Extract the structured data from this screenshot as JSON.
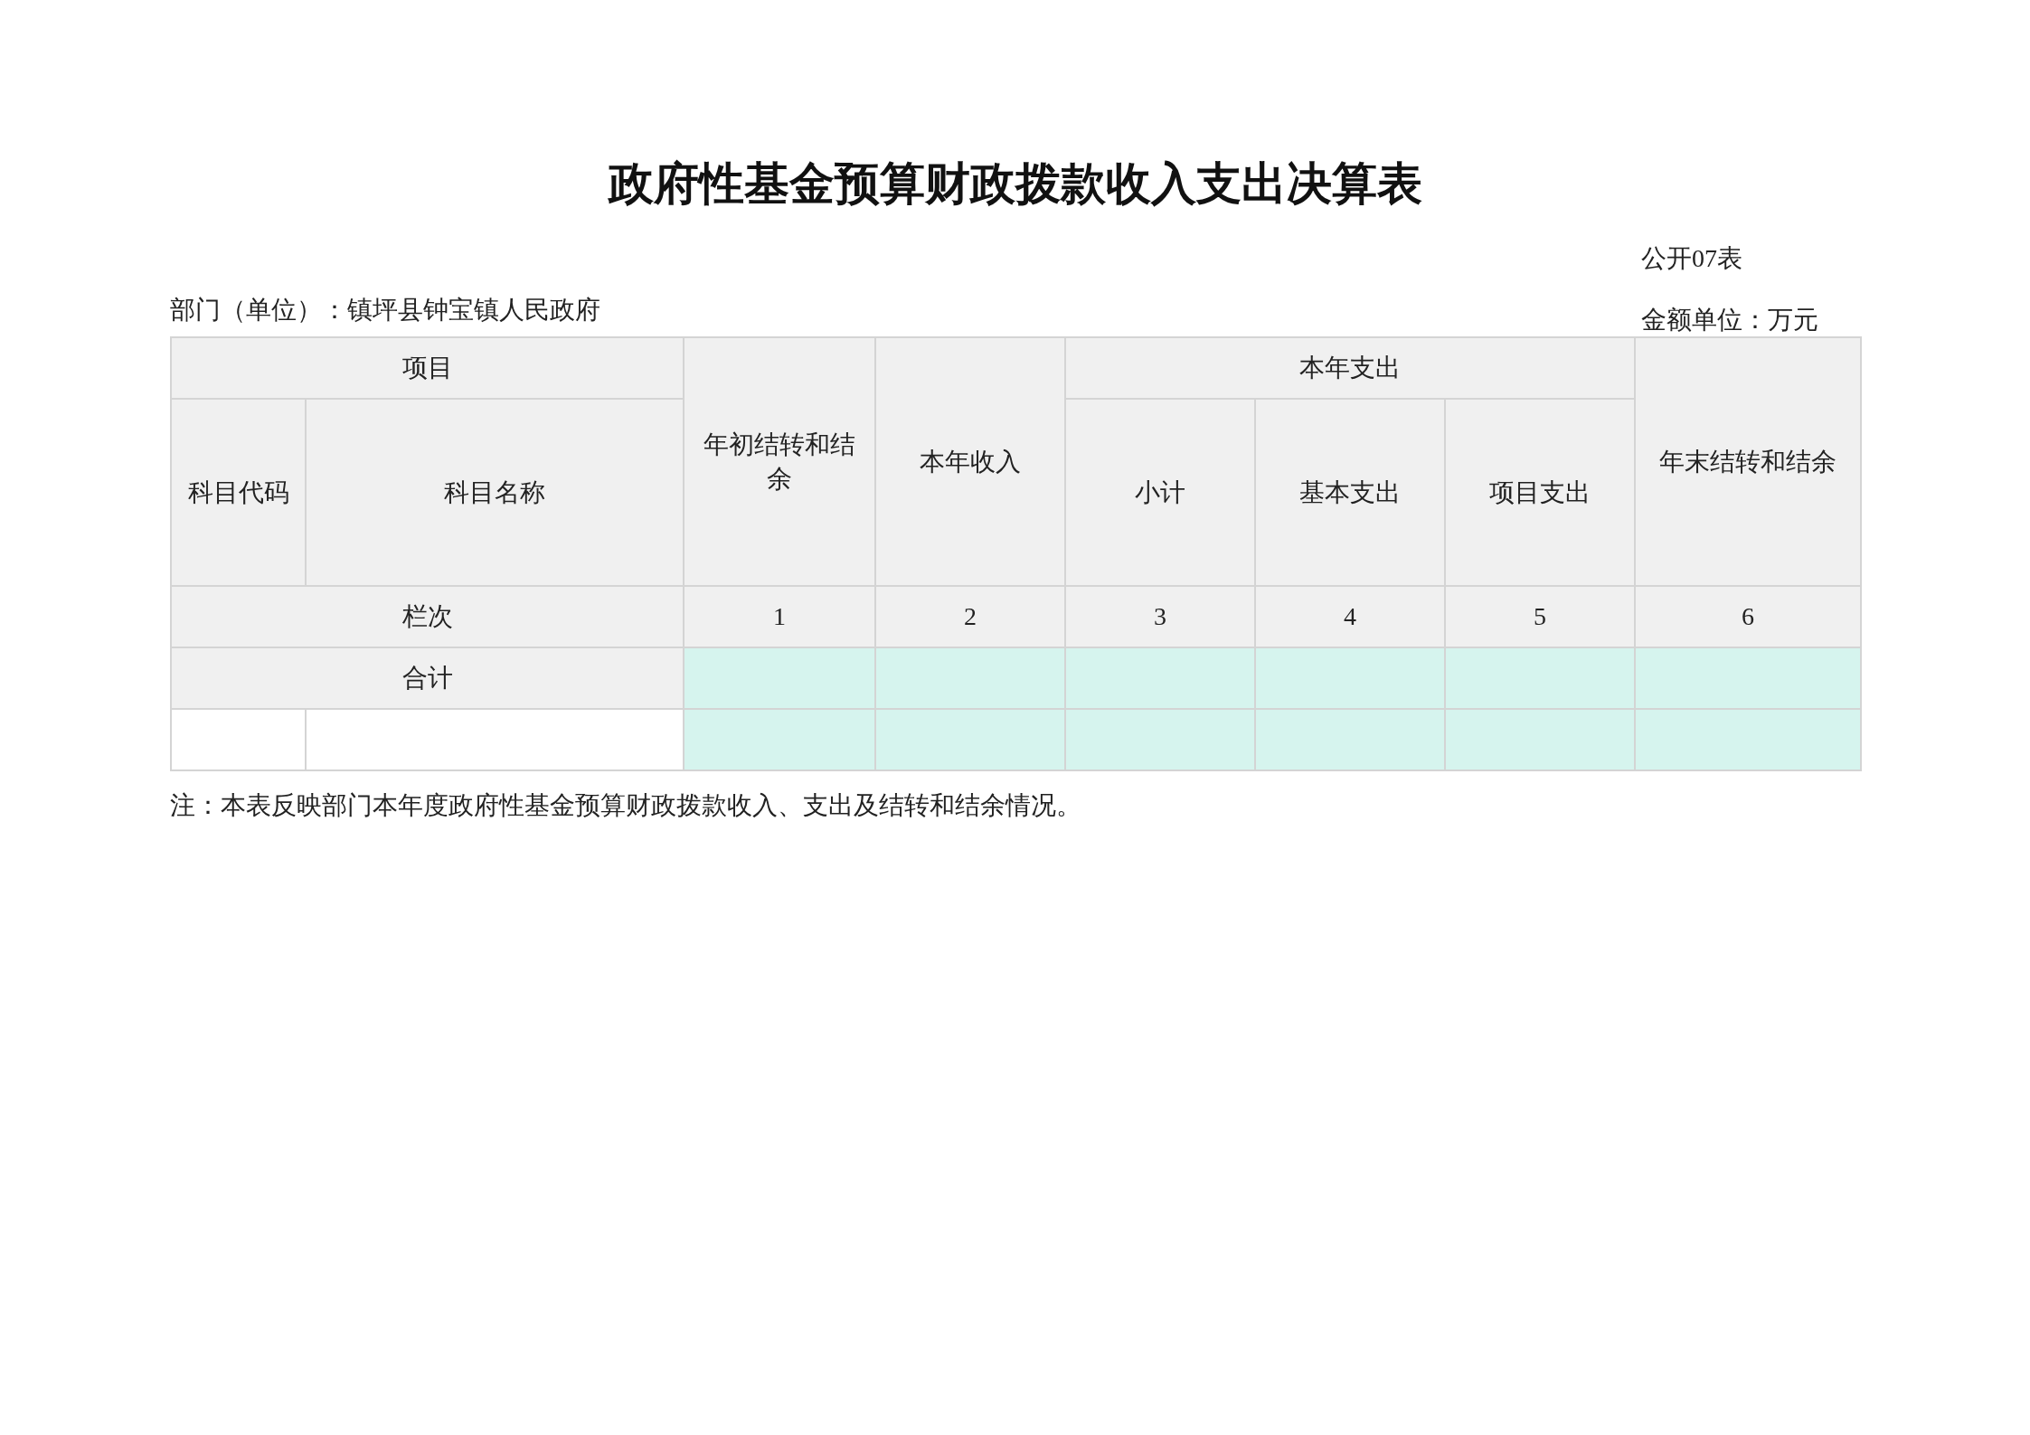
{
  "title": "政府性基金预算财政拨款收入支出决算表",
  "table_code": "公开07表",
  "department": "部门（单位）：镇坪县钟宝镇人民政府",
  "unit": "金额单位：万元",
  "table": {
    "head_row_1": [
      "项目",
      "年初结转和结余",
      "本年收入",
      "本年支出",
      "年末结转和结余"
    ],
    "head_row_2": [
      "科目代码",
      "科目名称",
      "小计",
      "基本支出",
      "项目支出"
    ],
    "column_row": {
      "label": "栏次",
      "numbers": [
        "1",
        "2",
        "3",
        "4",
        "5",
        "6"
      ]
    },
    "total_row": {
      "label": "合计"
    }
  },
  "note": "注：本表反映部门本年度政府性基金预算财政拨款收入、支出及结转和结余情况。"
}
